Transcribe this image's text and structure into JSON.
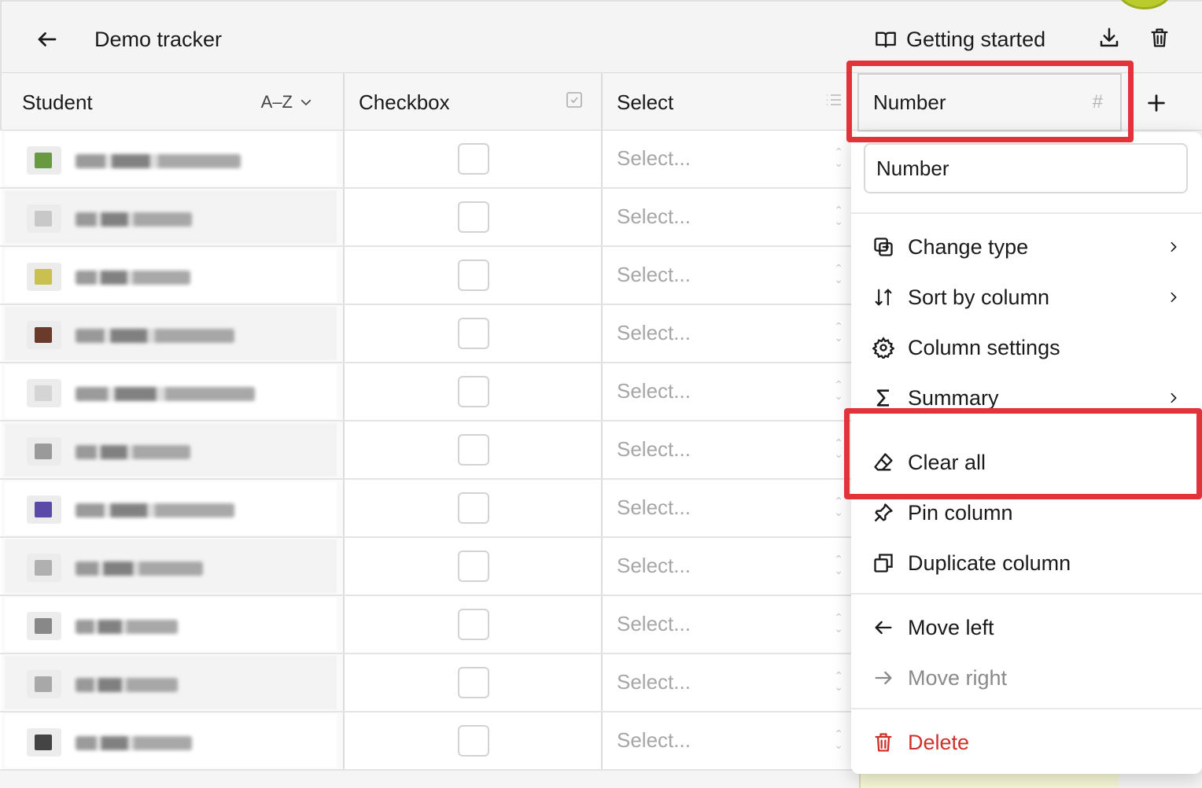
{
  "header": {
    "title": "Demo tracker",
    "getting_started": "Getting started"
  },
  "columns": {
    "student": {
      "label": "Student",
      "sort": "A–Z"
    },
    "checkbox": {
      "label": "Checkbox"
    },
    "select": {
      "label": "Select"
    },
    "number": {
      "label": "Number"
    }
  },
  "rows": {
    "select_placeholder": "Select...",
    "count": 11
  },
  "menu": {
    "name_value": "Number",
    "items": [
      {
        "label": "Change type",
        "icon": "change-type-icon",
        "submenu": true
      },
      {
        "label": "Sort by column",
        "icon": "sort-icon",
        "submenu": true
      },
      {
        "label": "Column settings",
        "icon": "gear-icon",
        "submenu": false
      },
      {
        "label": "Summary",
        "icon": "sigma-icon",
        "submenu": true
      },
      {
        "label": "Clear all",
        "icon": "eraser-icon",
        "submenu": false
      },
      {
        "label": "Pin column",
        "icon": "pin-icon",
        "submenu": false
      },
      {
        "label": "Duplicate column",
        "icon": "duplicate-icon",
        "submenu": false
      },
      {
        "label": "Move left",
        "icon": "arrow-left-icon",
        "submenu": false
      },
      {
        "label": "Move right",
        "icon": "arrow-right-icon",
        "submenu": false,
        "disabled": true
      },
      {
        "label": "Delete",
        "icon": "trash-icon",
        "submenu": false,
        "danger": true
      }
    ]
  },
  "colors": {
    "highlight": "#e2323a",
    "danger": "#d0302a",
    "muted": "#8a8a8a"
  }
}
